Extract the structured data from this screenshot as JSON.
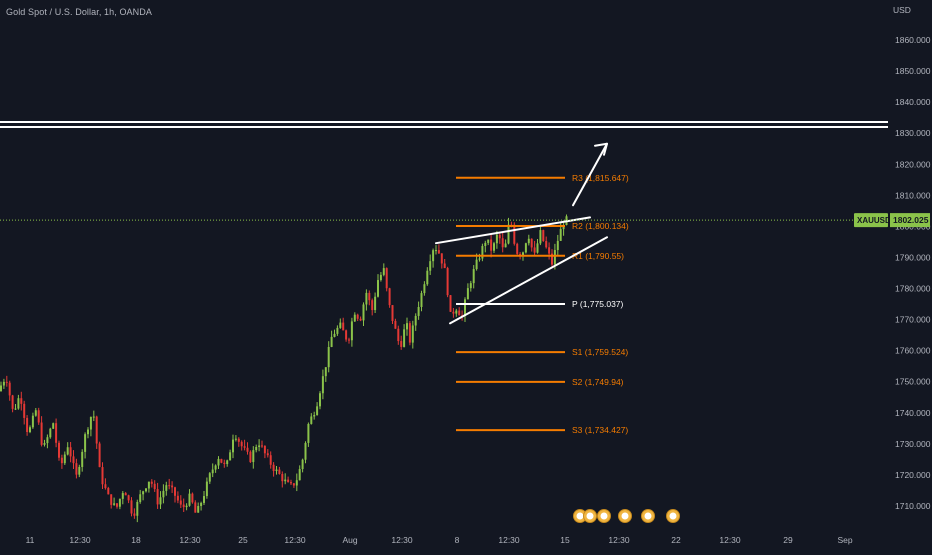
{
  "header": {
    "symbol_title": "Gold Spot / U.S. Dollar, 1h, OANDA",
    "currency": "USD"
  },
  "price_tag": {
    "symbol": "XAUUSD",
    "value": "1802.025",
    "price": 1802.025
  },
  "colors": {
    "background": "#131722",
    "up": "#8bc34a",
    "down": "#e53935",
    "pivot_orange": "#f57c00",
    "pivot_white": "#ffffff",
    "axis_text": "#b2b5be",
    "price_line": "#8bc34a"
  },
  "chart_data": {
    "type": "candlestick",
    "title": "Gold Spot / U.S. Dollar, 1h, OANDA",
    "ylabel": "USD",
    "ylim": [
      1704,
      1871
    ],
    "y_ticks": [
      {
        "label": "1860.000",
        "value": 1860
      },
      {
        "label": "1850.000",
        "value": 1850
      },
      {
        "label": "1840.000",
        "value": 1840
      },
      {
        "label": "1830.000",
        "value": 1830
      },
      {
        "label": "1820.000",
        "value": 1820
      },
      {
        "label": "1810.000",
        "value": 1810
      },
      {
        "label": "1800.000",
        "value": 1800
      },
      {
        "label": "1790.000",
        "value": 1790
      },
      {
        "label": "1780.000",
        "value": 1780
      },
      {
        "label": "1770.000",
        "value": 1770
      },
      {
        "label": "1760.000",
        "value": 1760
      },
      {
        "label": "1750.000",
        "value": 1750
      },
      {
        "label": "1740.000",
        "value": 1740
      },
      {
        "label": "1730.000",
        "value": 1730
      },
      {
        "label": "1720.000",
        "value": 1720
      },
      {
        "label": "1710.000",
        "value": 1710
      }
    ],
    "x_ticks": [
      "11",
      "12:30",
      "18",
      "12:30",
      "25",
      "12:30",
      "Aug",
      "12:30",
      "8",
      "12:30",
      "15",
      "12:30",
      "22",
      "12:30",
      "29",
      "Sep"
    ],
    "price_path": [
      [
        0,
        1747
      ],
      [
        8,
        1752
      ],
      [
        15,
        1740
      ],
      [
        22,
        1746
      ],
      [
        30,
        1733
      ],
      [
        38,
        1741
      ],
      [
        45,
        1728
      ],
      [
        55,
        1737
      ],
      [
        62,
        1722
      ],
      [
        70,
        1730
      ],
      [
        78,
        1719
      ],
      [
        88,
        1734
      ],
      [
        95,
        1741
      ],
      [
        102,
        1720
      ],
      [
        110,
        1713
      ],
      [
        118,
        1709
      ],
      [
        126,
        1716
      ],
      [
        135,
        1707
      ],
      [
        143,
        1714
      ],
      [
        152,
        1719
      ],
      [
        160,
        1711
      ],
      [
        168,
        1717
      ],
      [
        176,
        1714
      ],
      [
        184,
        1709
      ],
      [
        192,
        1713
      ],
      [
        198,
        1707
      ],
      [
        205,
        1713
      ],
      [
        212,
        1720
      ],
      [
        220,
        1726
      ],
      [
        228,
        1722
      ],
      [
        236,
        1734
      ],
      [
        244,
        1729
      ],
      [
        252,
        1725
      ],
      [
        260,
        1731
      ],
      [
        268,
        1726
      ],
      [
        276,
        1722
      ],
      [
        284,
        1719
      ],
      [
        292,
        1716
      ],
      [
        298,
        1718
      ],
      [
        304,
        1724
      ],
      [
        310,
        1736
      ],
      [
        318,
        1742
      ],
      [
        326,
        1753
      ],
      [
        334,
        1765
      ],
      [
        342,
        1768
      ],
      [
        350,
        1763
      ],
      [
        356,
        1773
      ],
      [
        362,
        1770
      ],
      [
        368,
        1779
      ],
      [
        374,
        1773
      ],
      [
        380,
        1783
      ],
      [
        386,
        1786
      ],
      [
        390,
        1776
      ],
      [
        396,
        1768
      ],
      [
        402,
        1761
      ],
      [
        408,
        1769
      ],
      [
        412,
        1763
      ],
      [
        418,
        1772
      ],
      [
        424,
        1779
      ],
      [
        430,
        1788
      ],
      [
        436,
        1794
      ],
      [
        442,
        1791
      ],
      [
        448,
        1784
      ],
      [
        452,
        1771
      ],
      [
        458,
        1774
      ],
      [
        464,
        1771
      ],
      [
        470,
        1780
      ],
      [
        476,
        1786
      ],
      [
        482,
        1791
      ],
      [
        488,
        1796
      ],
      [
        494,
        1792
      ],
      [
        500,
        1798
      ],
      [
        506,
        1791
      ],
      [
        512,
        1803
      ],
      [
        518,
        1792
      ],
      [
        524,
        1791
      ],
      [
        530,
        1798
      ],
      [
        536,
        1790
      ],
      [
        542,
        1798
      ],
      [
        548,
        1793
      ],
      [
        554,
        1788
      ],
      [
        560,
        1796
      ],
      [
        566,
        1802
      ]
    ],
    "pivots": [
      {
        "label": "R3 (1,815.647)",
        "value": 1815.647,
        "color": "orange",
        "x0": 456,
        "x1": 565
      },
      {
        "label": "R2 (1,800.134)",
        "value": 1800.134,
        "color": "orange",
        "x0": 456,
        "x1": 565
      },
      {
        "label": "R1 (1,790.55)",
        "value": 1790.55,
        "color": "orange",
        "x0": 456,
        "x1": 565
      },
      {
        "label": "P (1,775.037)",
        "value": 1775.037,
        "color": "white",
        "x0": 456,
        "x1": 565
      },
      {
        "label": "S1 (1,759.524)",
        "value": 1759.524,
        "color": "orange",
        "x0": 456,
        "x1": 565
      },
      {
        "label": "S2 (1,749.94)",
        "value": 1749.94,
        "color": "orange",
        "x0": 456,
        "x1": 565
      },
      {
        "label": "S3 (1,734.427)",
        "value": 1734.427,
        "color": "orange",
        "x0": 456,
        "x1": 565
      }
    ],
    "resistance_lines": [
      1833.6,
      1832.0
    ],
    "drawings": [
      {
        "name": "upper-trendline",
        "x0": 436,
        "y0": 1794.6,
        "x1": 590,
        "y1": 1802.9
      },
      {
        "name": "lower-trendline",
        "x0": 450,
        "y0": 1768.8,
        "x1": 607,
        "y1": 1796.5
      },
      {
        "name": "breakout-arrow",
        "x0": 573,
        "y0": 1806.8,
        "x1": 607,
        "y1": 1826.6
      }
    ],
    "legend": "none",
    "grid": false
  },
  "event_markers": [
    "E",
    "E",
    "E",
    "E",
    "E",
    "E"
  ]
}
